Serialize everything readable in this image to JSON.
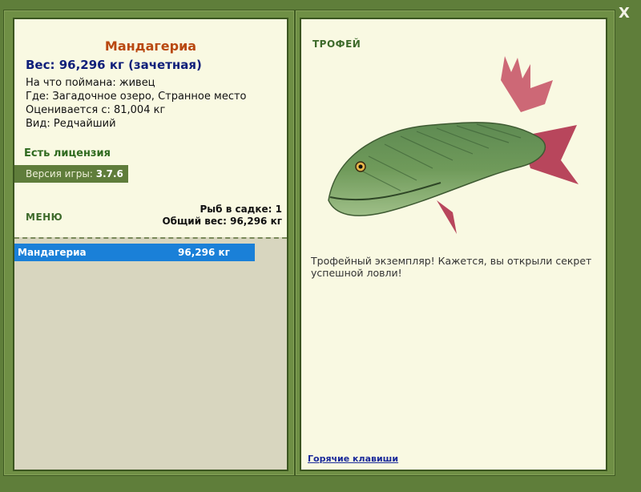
{
  "window": {
    "close_label": "X"
  },
  "left_panel": {
    "fish_name": "Мандагериа",
    "weight_line": "Вес: 96,296 кг (зачетная)",
    "info": [
      "На что поймана: живец",
      "Где: Загадочное озеро, Странное место",
      "Оценивается с: 81,004 кг",
      "Вид: Редчайший"
    ],
    "license": "Есть лицензия",
    "version_label": "Версия игры:",
    "version_value": "3.7.6",
    "menu_label": "МЕНЮ",
    "cage_count": "Рыб в садке: 1",
    "cage_weight": "Общий вес: 96,296 кг",
    "list": [
      {
        "name": "Мандагериа",
        "weight": "96,296 кг"
      }
    ]
  },
  "right_panel": {
    "title": "ТРОФЕЙ",
    "description": "Трофейный экземпляр! Кажется, вы открыли секрет успешной ловли!",
    "hotkeys_link": "Горячие клавиши"
  },
  "colors": {
    "frame": "#6f8f45",
    "panel_bg": "#f9f9e2",
    "accent_name": "#b94810",
    "weight_text": "#10207a",
    "selected_row": "#1a80d8"
  },
  "icons": {
    "close": "close-icon",
    "fish": "fish-trophy-image"
  }
}
